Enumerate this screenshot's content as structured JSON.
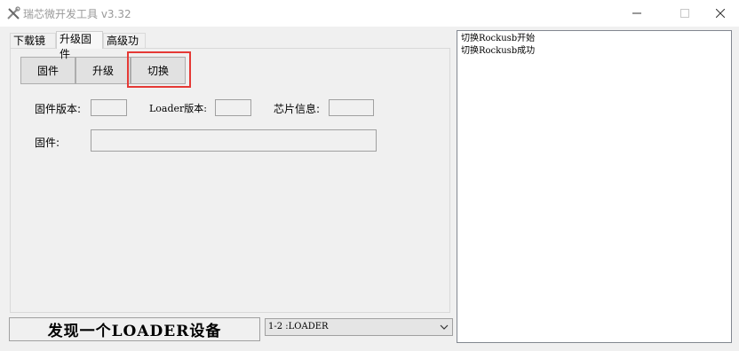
{
  "window": {
    "title": "瑞芯微开发工具 v3.32",
    "icons": {
      "app": "tools-icon",
      "minimize": "minimize-icon",
      "maximize": "maximize-icon",
      "close": "close-icon"
    }
  },
  "tabs": [
    {
      "label": "下载镜像",
      "active": false
    },
    {
      "label": "升级固件",
      "active": true
    },
    {
      "label": "高级功能",
      "active": false
    }
  ],
  "buttons": {
    "firmware": "固件",
    "upgrade": "升级",
    "switch": "切换"
  },
  "fields": {
    "firmware_version_label": "固件版本:",
    "firmware_version_value": "",
    "loader_version_label": "Loader版本:",
    "loader_version_value": "",
    "chip_info_label": "芯片信息:",
    "chip_info_value": "",
    "firmware_path_label": "固件:",
    "firmware_path_value": ""
  },
  "status": {
    "text": "发现一个LOADER设备",
    "device_selected": "1-2  :LOADER"
  },
  "log": {
    "lines": [
      "切换Rockusb开始",
      "切换Rockusb成功"
    ]
  },
  "colors": {
    "highlight": "#e53935",
    "window_bg": "#f0f0f0",
    "log_bg": "#ffffff"
  }
}
